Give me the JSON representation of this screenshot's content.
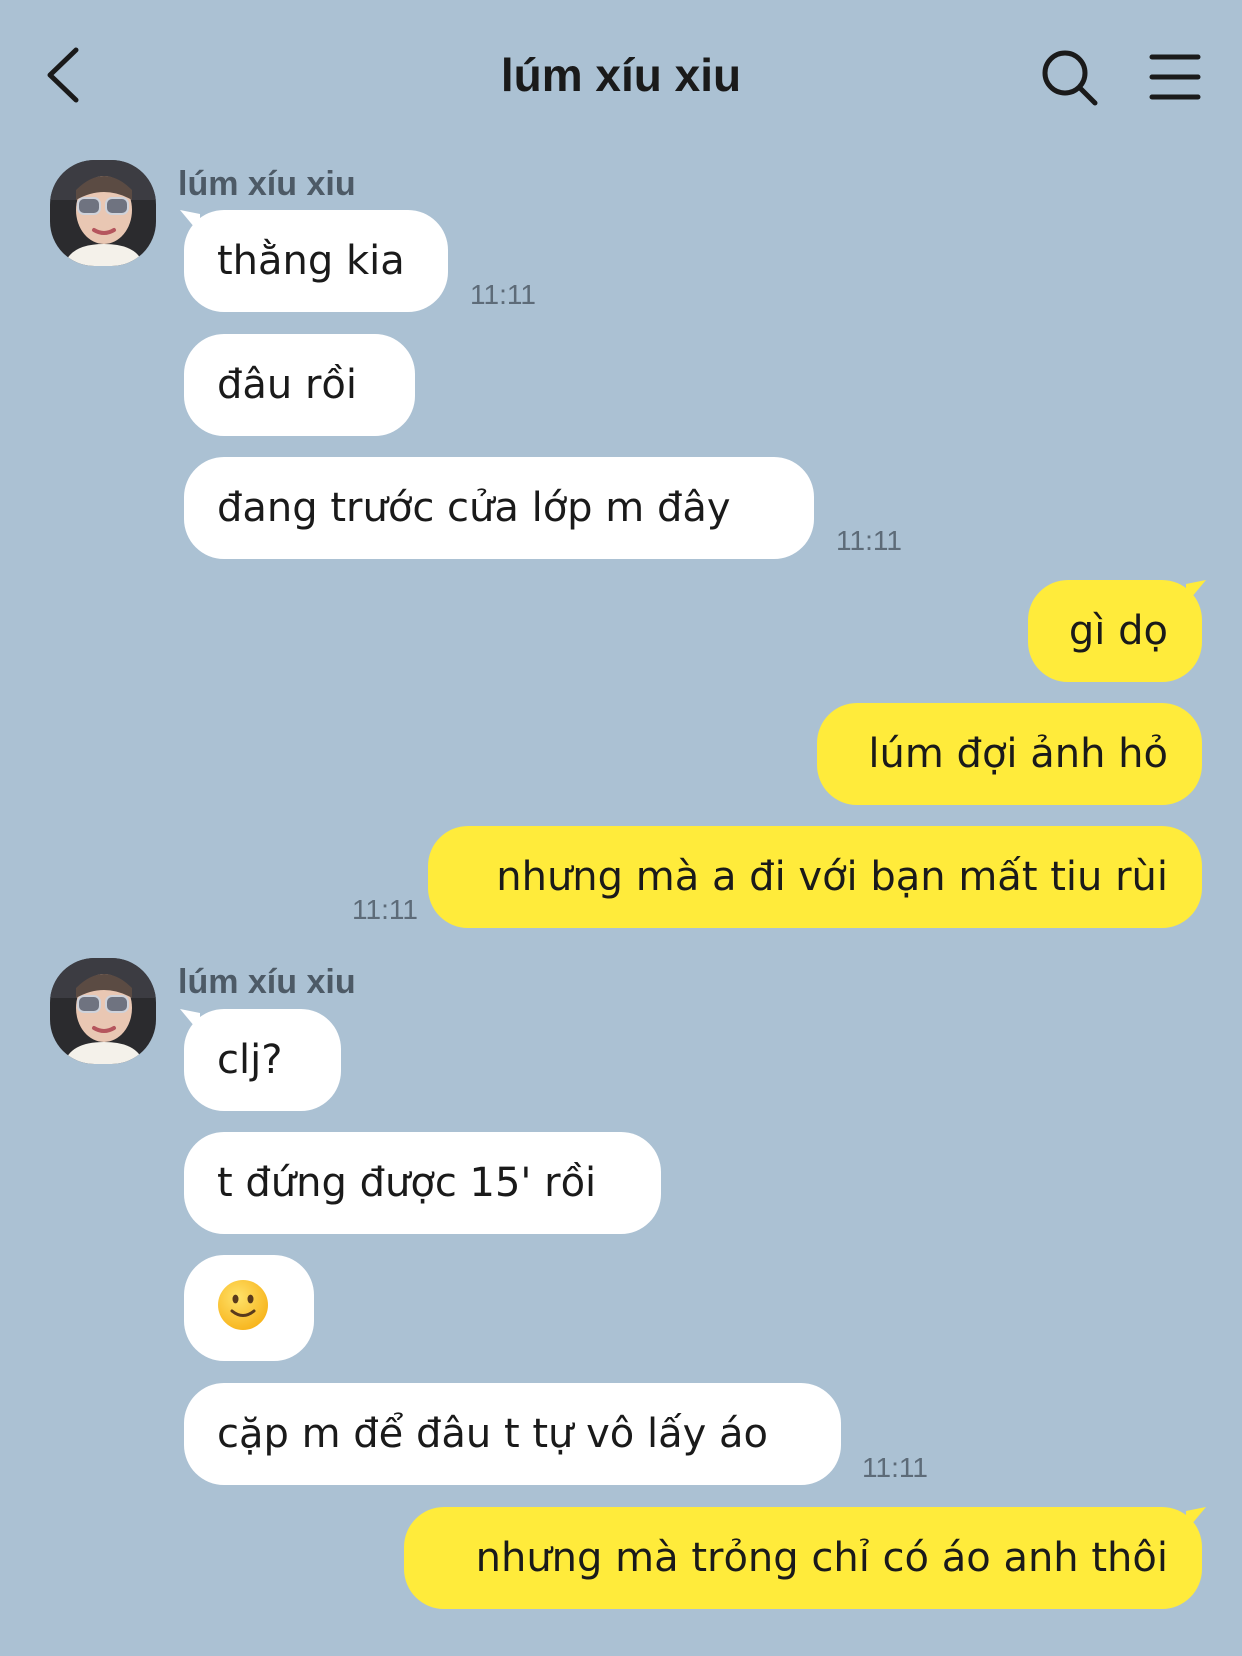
{
  "header": {
    "title": "lúm xíu xiu"
  },
  "colors": {
    "background": "#abc1d3",
    "incoming_bubble": "#ffffff",
    "outgoing_bubble": "#ffeb3b"
  },
  "icons": [
    "back-chevron-icon",
    "search-icon",
    "menu-icon",
    "smiling-face-emoji"
  ],
  "messages": [
    {
      "id": "m1",
      "direction": "incoming",
      "sender": "lúm xíu xiu",
      "text": "thằng kia",
      "time": "11:11"
    },
    {
      "id": "m2",
      "direction": "incoming",
      "text": "đâu rồi"
    },
    {
      "id": "m3",
      "direction": "incoming",
      "text": "đang trước cửa lớp m đây",
      "time": "11:11"
    },
    {
      "id": "m4",
      "direction": "outgoing",
      "text": "gì dọ"
    },
    {
      "id": "m5",
      "direction": "outgoing",
      "text": "lúm đợi ảnh hỏ"
    },
    {
      "id": "m6",
      "direction": "outgoing",
      "text": "nhưng mà a đi với bạn mất tiu rùi",
      "time": "11:11"
    },
    {
      "id": "m7",
      "direction": "incoming",
      "sender": "lúm xíu xiu",
      "text": "clj?"
    },
    {
      "id": "m8",
      "direction": "incoming",
      "text": "t đứng được 15' rồi"
    },
    {
      "id": "m9",
      "direction": "incoming",
      "emoji": "slightly-smiling-face"
    },
    {
      "id": "m10",
      "direction": "incoming",
      "text": "cặp m để đâu t tự vô lấy áo",
      "time": "11:11"
    },
    {
      "id": "m11",
      "direction": "outgoing",
      "text": "nhưng mà trỏng chỉ có áo anh thôi"
    }
  ]
}
